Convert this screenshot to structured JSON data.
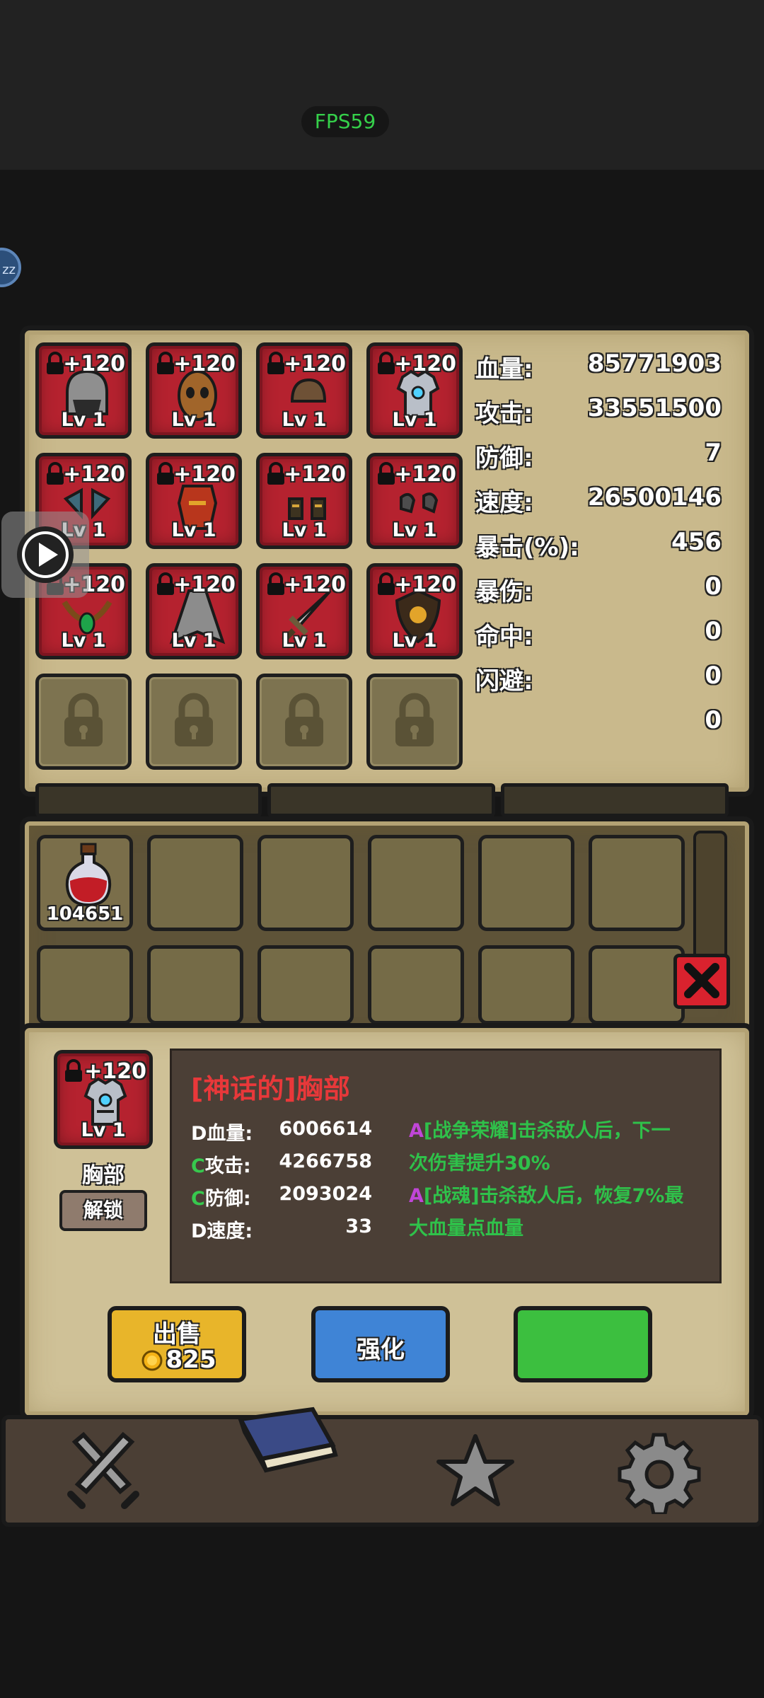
{
  "status": {
    "fps": "FPS59",
    "side_bubble": "zz"
  },
  "equipment_slots": [
    {
      "plus": "+120",
      "level": "Lv 1",
      "icon": "helmet-icon"
    },
    {
      "plus": "+120",
      "level": "Lv 1",
      "icon": "mask-icon"
    },
    {
      "plus": "+120",
      "level": "Lv 1",
      "icon": "cap-icon"
    },
    {
      "plus": "+120",
      "level": "Lv 1",
      "icon": "chest-armor-icon"
    },
    {
      "plus": "+120",
      "level": "Lv 1",
      "icon": "shoulder-icon"
    },
    {
      "plus": "+120",
      "level": "Lv 1",
      "icon": "body-armor-icon"
    },
    {
      "plus": "+120",
      "level": "Lv 1",
      "icon": "boots-icon"
    },
    {
      "plus": "+120",
      "level": "Lv 1",
      "icon": "gloves-icon"
    },
    {
      "plus": "+120",
      "level": "Lv 1",
      "icon": "necklace-icon"
    },
    {
      "plus": "+120",
      "level": "Lv 1",
      "icon": "cape-icon"
    },
    {
      "plus": "+120",
      "level": "Lv 1",
      "icon": "sword-icon"
    },
    {
      "plus": "+120",
      "level": "Lv 1",
      "icon": "shield-icon"
    }
  ],
  "stats": [
    {
      "label": "血量:",
      "value": "85771903"
    },
    {
      "label": "攻击:",
      "value": "33551500"
    },
    {
      "label": "防御:",
      "value": "7"
    },
    {
      "label": "速度:",
      "value": "26500146"
    },
    {
      "label": "暴击(%):",
      "value": "456"
    },
    {
      "label": "暴伤:",
      "value": "0"
    },
    {
      "label": "命中:",
      "value": "0"
    },
    {
      "label": "闪避:",
      "value": "0"
    },
    {
      "label": "",
      "value": "0"
    }
  ],
  "inventory": {
    "potion_count": "104651",
    "potion_icon": "red-potion-icon"
  },
  "detail": {
    "plus": "+120",
    "level": "Lv 1",
    "slot_name": "胸部",
    "unlock_label": "解锁",
    "title": "[神话的]胸部",
    "stats": [
      {
        "grade": "D",
        "label": "血量:",
        "value": "6006614"
      },
      {
        "grade": "C",
        "label": "攻击:",
        "value": "4266758"
      },
      {
        "grade": "C",
        "label": "防御:",
        "value": "2093024"
      },
      {
        "grade": "D",
        "label": "速度:",
        "value": "33"
      }
    ],
    "desc_lines": [
      {
        "grade": "A",
        "text": "[战争荣耀]击杀敌人后，下一"
      },
      {
        "grade": "",
        "text": "次伤害提升30%"
      },
      {
        "grade": "A",
        "text": "[战魂]击杀敌人后，恢复7%最"
      },
      {
        "grade": "",
        "text": "大血量点血量"
      }
    ]
  },
  "buttons": {
    "sell_label": "出售",
    "sell_price": "825",
    "upgrade_label": "强化"
  },
  "colors": {
    "title_red": "#e8383a",
    "grade_c": "#37c84e",
    "grade_a": "#c046d8",
    "desc_green": "#2fc14a"
  }
}
